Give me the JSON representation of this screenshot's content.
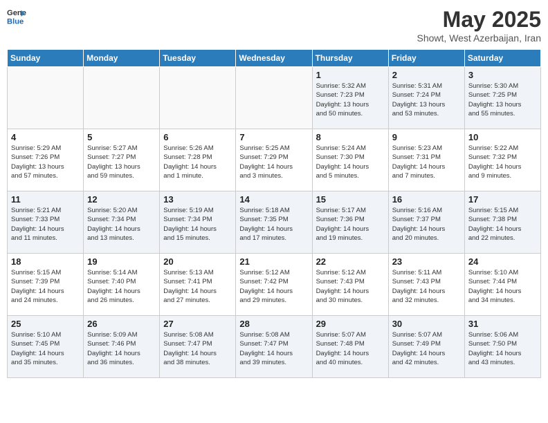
{
  "header": {
    "logo_general": "General",
    "logo_blue": "Blue",
    "title": "May 2025",
    "subtitle": "Showt, West Azerbaijan, Iran"
  },
  "weekdays": [
    "Sunday",
    "Monday",
    "Tuesday",
    "Wednesday",
    "Thursday",
    "Friday",
    "Saturday"
  ],
  "weeks": [
    [
      {
        "day": "",
        "info": ""
      },
      {
        "day": "",
        "info": ""
      },
      {
        "day": "",
        "info": ""
      },
      {
        "day": "",
        "info": ""
      },
      {
        "day": "1",
        "info": "Sunrise: 5:32 AM\nSunset: 7:23 PM\nDaylight: 13 hours\nand 50 minutes."
      },
      {
        "day": "2",
        "info": "Sunrise: 5:31 AM\nSunset: 7:24 PM\nDaylight: 13 hours\nand 53 minutes."
      },
      {
        "day": "3",
        "info": "Sunrise: 5:30 AM\nSunset: 7:25 PM\nDaylight: 13 hours\nand 55 minutes."
      }
    ],
    [
      {
        "day": "4",
        "info": "Sunrise: 5:29 AM\nSunset: 7:26 PM\nDaylight: 13 hours\nand 57 minutes."
      },
      {
        "day": "5",
        "info": "Sunrise: 5:27 AM\nSunset: 7:27 PM\nDaylight: 13 hours\nand 59 minutes."
      },
      {
        "day": "6",
        "info": "Sunrise: 5:26 AM\nSunset: 7:28 PM\nDaylight: 14 hours\nand 1 minute."
      },
      {
        "day": "7",
        "info": "Sunrise: 5:25 AM\nSunset: 7:29 PM\nDaylight: 14 hours\nand 3 minutes."
      },
      {
        "day": "8",
        "info": "Sunrise: 5:24 AM\nSunset: 7:30 PM\nDaylight: 14 hours\nand 5 minutes."
      },
      {
        "day": "9",
        "info": "Sunrise: 5:23 AM\nSunset: 7:31 PM\nDaylight: 14 hours\nand 7 minutes."
      },
      {
        "day": "10",
        "info": "Sunrise: 5:22 AM\nSunset: 7:32 PM\nDaylight: 14 hours\nand 9 minutes."
      }
    ],
    [
      {
        "day": "11",
        "info": "Sunrise: 5:21 AM\nSunset: 7:33 PM\nDaylight: 14 hours\nand 11 minutes."
      },
      {
        "day": "12",
        "info": "Sunrise: 5:20 AM\nSunset: 7:34 PM\nDaylight: 14 hours\nand 13 minutes."
      },
      {
        "day": "13",
        "info": "Sunrise: 5:19 AM\nSunset: 7:34 PM\nDaylight: 14 hours\nand 15 minutes."
      },
      {
        "day": "14",
        "info": "Sunrise: 5:18 AM\nSunset: 7:35 PM\nDaylight: 14 hours\nand 17 minutes."
      },
      {
        "day": "15",
        "info": "Sunrise: 5:17 AM\nSunset: 7:36 PM\nDaylight: 14 hours\nand 19 minutes."
      },
      {
        "day": "16",
        "info": "Sunrise: 5:16 AM\nSunset: 7:37 PM\nDaylight: 14 hours\nand 20 minutes."
      },
      {
        "day": "17",
        "info": "Sunrise: 5:15 AM\nSunset: 7:38 PM\nDaylight: 14 hours\nand 22 minutes."
      }
    ],
    [
      {
        "day": "18",
        "info": "Sunrise: 5:15 AM\nSunset: 7:39 PM\nDaylight: 14 hours\nand 24 minutes."
      },
      {
        "day": "19",
        "info": "Sunrise: 5:14 AM\nSunset: 7:40 PM\nDaylight: 14 hours\nand 26 minutes."
      },
      {
        "day": "20",
        "info": "Sunrise: 5:13 AM\nSunset: 7:41 PM\nDaylight: 14 hours\nand 27 minutes."
      },
      {
        "day": "21",
        "info": "Sunrise: 5:12 AM\nSunset: 7:42 PM\nDaylight: 14 hours\nand 29 minutes."
      },
      {
        "day": "22",
        "info": "Sunrise: 5:12 AM\nSunset: 7:43 PM\nDaylight: 14 hours\nand 30 minutes."
      },
      {
        "day": "23",
        "info": "Sunrise: 5:11 AM\nSunset: 7:43 PM\nDaylight: 14 hours\nand 32 minutes."
      },
      {
        "day": "24",
        "info": "Sunrise: 5:10 AM\nSunset: 7:44 PM\nDaylight: 14 hours\nand 34 minutes."
      }
    ],
    [
      {
        "day": "25",
        "info": "Sunrise: 5:10 AM\nSunset: 7:45 PM\nDaylight: 14 hours\nand 35 minutes."
      },
      {
        "day": "26",
        "info": "Sunrise: 5:09 AM\nSunset: 7:46 PM\nDaylight: 14 hours\nand 36 minutes."
      },
      {
        "day": "27",
        "info": "Sunrise: 5:08 AM\nSunset: 7:47 PM\nDaylight: 14 hours\nand 38 minutes."
      },
      {
        "day": "28",
        "info": "Sunrise: 5:08 AM\nSunset: 7:47 PM\nDaylight: 14 hours\nand 39 minutes."
      },
      {
        "day": "29",
        "info": "Sunrise: 5:07 AM\nSunset: 7:48 PM\nDaylight: 14 hours\nand 40 minutes."
      },
      {
        "day": "30",
        "info": "Sunrise: 5:07 AM\nSunset: 7:49 PM\nDaylight: 14 hours\nand 42 minutes."
      },
      {
        "day": "31",
        "info": "Sunrise: 5:06 AM\nSunset: 7:50 PM\nDaylight: 14 hours\nand 43 minutes."
      }
    ]
  ]
}
